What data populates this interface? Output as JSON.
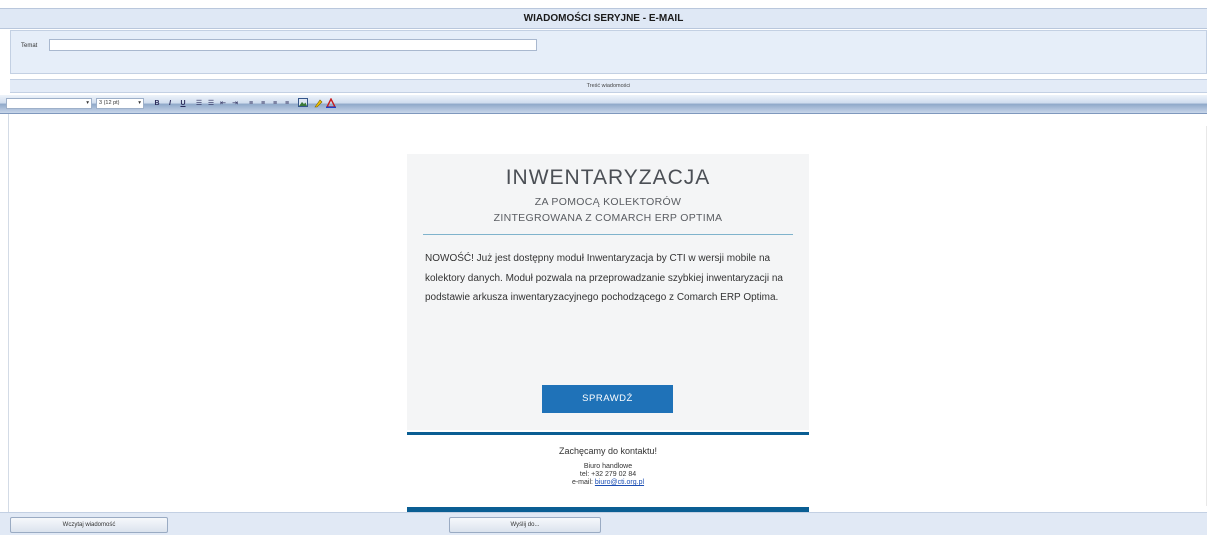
{
  "window": {
    "title": "WIADOMOŚCI SERYJNE - E-MAIL"
  },
  "subject": {
    "label": "Temat",
    "value": ""
  },
  "content_header": "Treść wiadomości",
  "toolbar": {
    "font_value": "",
    "size_value": "3 (12 pt)",
    "bold": "B",
    "italic": "I",
    "underline": "U",
    "icons": [
      "numbered-list-icon",
      "bullet-list-icon",
      "outdent-icon",
      "indent-icon",
      "align-left-icon",
      "align-center-icon",
      "align-right-icon",
      "justify-icon",
      "image-icon",
      "highlight-icon",
      "font-color-icon"
    ]
  },
  "email": {
    "title": "INWENTARYZACJA",
    "subtitle1": "ZA POMOCĄ KOLEKTORÓW",
    "subtitle2": "ZINTEGROWANA Z COMARCH ERP OPTIMA",
    "body": "NOWOŚĆ! Już jest dostępny moduł Inwentaryzacja by CTI w wersji mobile na kolektory danych. Moduł pozwala na przeprowadzanie szybkiej inwentaryzacji na podstawie arkusza inwentaryzacyjnego pochodzącego z Comarch ERP Optima.",
    "button": "SPRAWDŹ",
    "footer_title": "Zachęcamy do kontaktu!",
    "footer_office": "Biuro handlowe",
    "footer_tel": "tel: +32 279 02 84",
    "footer_email_label": "e-mail:",
    "footer_email": "biuro@cti.org.pl",
    "accent_color": "#1f72b8"
  },
  "bottom": {
    "load_button": "Wczytaj wiadomość",
    "send_button": "Wyślij do..."
  }
}
